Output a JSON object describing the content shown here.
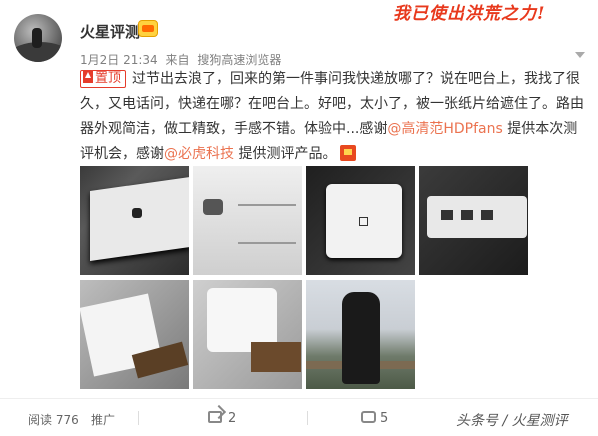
{
  "header": {
    "username": "火星评测",
    "banner": "我已使出洪荒之力!",
    "time": "1月2日 21:34",
    "source_prefix": "来自",
    "source": "搜狗高速浏览器"
  },
  "post": {
    "pin_label": "置顶",
    "text_1": "过节出去浪了，回来的第一件事问我快递放哪了？说在吧台上，我找了很久，又电话问，快递在哪？在吧台上。好吧，太小了，被一张纸片给遮住了。路由器外观简洁，做工精致，手感不错。体验中...感谢",
    "mention_1": "@高清范HDPfans",
    "text_2": " 提供本次测评机会，感谢",
    "mention_2": "@必虎科技",
    "text_3": " 提供测评产品。"
  },
  "photos": [
    "router-box",
    "router-box-label",
    "router-top",
    "router-ports",
    "router-with-tag",
    "router-on-stand",
    "person-outdoors"
  ],
  "footer": {
    "read_label": "阅读 776",
    "promote_label": "推广",
    "share_count": "2",
    "comment_count": "5",
    "watermark": "头条号 / 火星测评"
  },
  "colors": {
    "link": "#eb7350",
    "pin": "#e53c2b",
    "banner": "#e8391d"
  }
}
